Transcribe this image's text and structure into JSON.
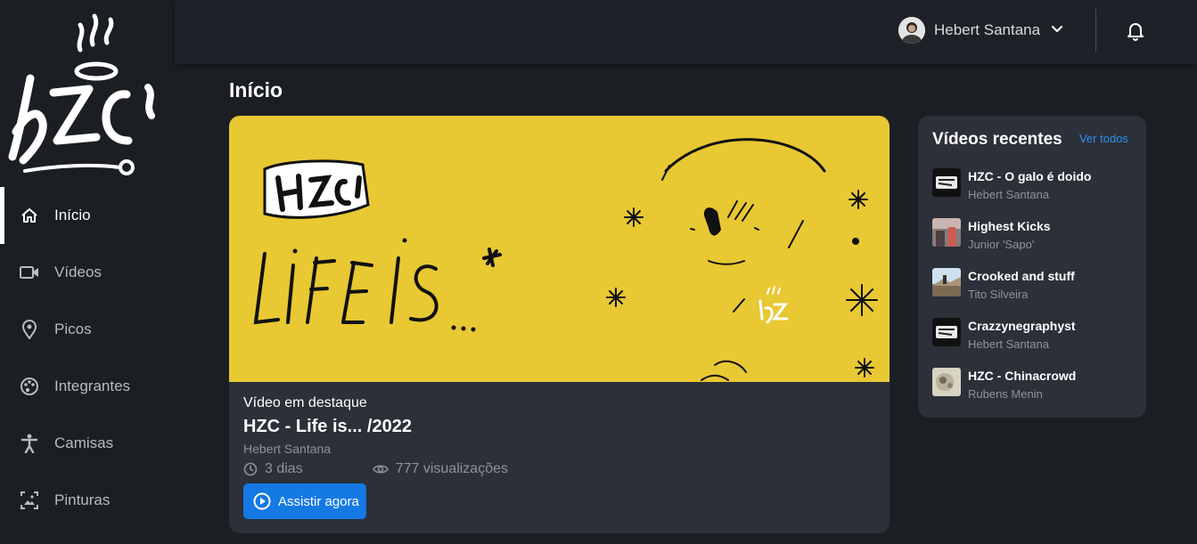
{
  "brand": {
    "logo_text": "HZC"
  },
  "sidebar": {
    "items": [
      {
        "label": "Início",
        "icon": "home-icon",
        "active": true
      },
      {
        "label": "Vídeos",
        "icon": "video-camera-icon",
        "active": false
      },
      {
        "label": "Picos",
        "icon": "map-pin-icon",
        "active": false
      },
      {
        "label": "Integrantes",
        "icon": "palette-icon",
        "active": false
      },
      {
        "label": "Camisas",
        "icon": "person-icon",
        "active": false
      },
      {
        "label": "Pinturas",
        "icon": "image-frame-icon",
        "active": false
      }
    ]
  },
  "header": {
    "user_name": "Hebert Santana",
    "dropdown_icon": "chevron-down-icon",
    "notifications_icon": "bell-icon"
  },
  "page": {
    "title": "Início"
  },
  "featured": {
    "label": "Vídeo em destaque",
    "title": "HZC - Life is... /2022",
    "author": "Hebert Santana",
    "age": "3 dias",
    "views": "777 visualizações",
    "watch_label": "Assistir agora",
    "banner_color": "#e8c833",
    "banner_text": "LIFE IS ..."
  },
  "recent": {
    "title": "Vídeos recentes",
    "see_all": "Ver todos",
    "items": [
      {
        "title": "HZC - O galo é doido",
        "author": "Hebert Santana"
      },
      {
        "title": "Highest Kicks",
        "author": "Junior 'Sapo'"
      },
      {
        "title": "Crooked and stuff",
        "author": "Tito Silveira"
      },
      {
        "title": "Crazzynegraphyst",
        "author": "Hebert Santana"
      },
      {
        "title": "HZC - Chinacrowd",
        "author": "Rubens Menin"
      }
    ]
  },
  "colors": {
    "accent": "#1479e3",
    "link": "#2d8ff0",
    "panel": "#2c3038",
    "background": "#1b1e23"
  }
}
